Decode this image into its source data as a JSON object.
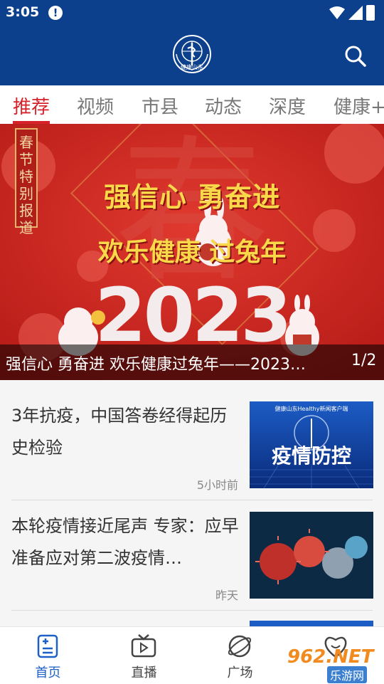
{
  "status_bar": {
    "time": "3:05",
    "alert_icon": "!"
  },
  "app_bar": {
    "logo_text": "健康山东",
    "search_icon": "search-icon"
  },
  "tabs": [
    {
      "label": "推荐",
      "active": true
    },
    {
      "label": "视频"
    },
    {
      "label": "市县"
    },
    {
      "label": "动态"
    },
    {
      "label": "深度"
    },
    {
      "label": "健康+"
    }
  ],
  "banner": {
    "tag": "春节特别报道",
    "headline_1": "强信心 勇奋进",
    "headline_2": "欢乐健康 过兔年",
    "year": "2023",
    "caption": "强信心 勇奋进 欢乐健康过兔年——2023…",
    "page": "1/2",
    "background_color": "#c9231f"
  },
  "news": [
    {
      "title": "3年抗疫，中国答卷经得起历史检验",
      "time": "5小时前",
      "thumb_text": "疫情防控",
      "thumb_header": "健康山东Healthy新闻客户端"
    },
    {
      "title": "本轮疫情接近尾声 专家：应早准备应对第二波疫情…",
      "time": "昨天"
    }
  ],
  "bottom_nav": [
    {
      "label": "首页",
      "icon": "home-news-icon",
      "active": true
    },
    {
      "label": "直播",
      "icon": "tv-icon"
    },
    {
      "label": "广场",
      "icon": "planet-icon"
    },
    {
      "label": "",
      "icon": "heart-smile-icon"
    }
  ],
  "watermark": {
    "number": "962.NET",
    "text": "乐游网"
  },
  "colors": {
    "primary": "#0c3f8c",
    "accent": "#d6232b",
    "nav_active": "#1d60c8"
  }
}
